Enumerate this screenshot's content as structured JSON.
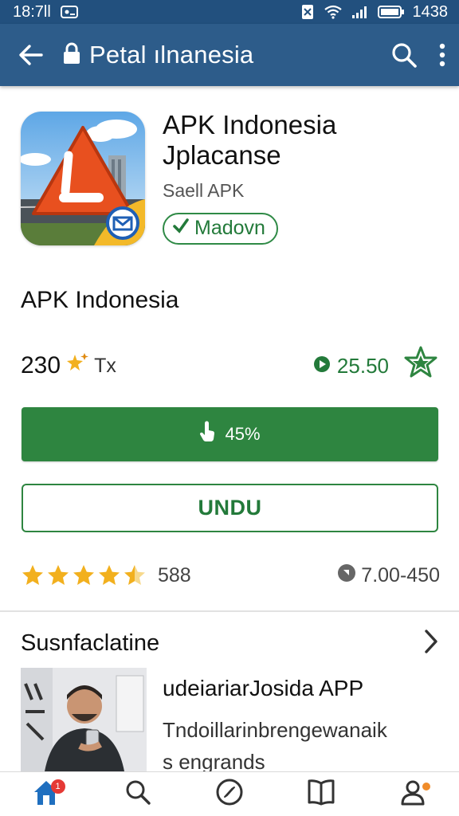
{
  "status_bar": {
    "time": "18:7ll",
    "clock_right": "1438"
  },
  "app_bar": {
    "title": "Petal ılnanesia"
  },
  "app": {
    "name_line1": "APK Indonesia",
    "name_line2": "Jplacanse",
    "subtitle": "Saell APK",
    "badge": "Madovn"
  },
  "section_title": "APK Indonesia",
  "stats": {
    "left_value": "230",
    "left_unit": "Tx",
    "right_value": "25.50"
  },
  "install_button": {
    "label": "45%"
  },
  "download_button": {
    "label": "UNDU"
  },
  "rating": {
    "stars": 4.5,
    "count": "588",
    "size": "7.00-450"
  },
  "list": {
    "header": "Susnfaclatine",
    "item": {
      "title": "udeiariarJosida APP",
      "description_line1": "Tndoillarinbrengewanaik",
      "description_line2": "s engrands"
    }
  },
  "bottom_nav": {
    "home_badge": "1",
    "items": [
      "home-icon",
      "search-icon",
      "compass-icon",
      "book-icon",
      "profile-icon"
    ]
  },
  "colors": {
    "app_bar": "#2d5c8a",
    "status_bar": "#22507e",
    "accent_green": "#2e8540",
    "star": "#f2b01e"
  }
}
